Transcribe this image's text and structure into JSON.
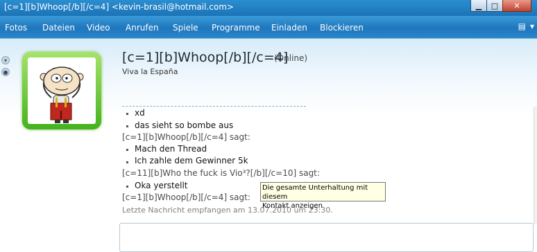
{
  "window": {
    "title": "[c=1][b]Whoop[/b][/c=4] <kevin-brasil@hotmail.com>"
  },
  "menu": {
    "items": [
      {
        "label": "Fotos"
      },
      {
        "label": "Dateien"
      },
      {
        "label": "Video"
      },
      {
        "label": "Anrufen"
      },
      {
        "label": "Spiele"
      },
      {
        "label": "Programme"
      },
      {
        "label": "Einladen"
      },
      {
        "label": "Blockieren"
      }
    ]
  },
  "contact": {
    "name": "[c=1][b]Whoop[/b][/c=4]",
    "status": "(Online)",
    "personal_message": "Viva la España"
  },
  "conversation": {
    "lines": [
      {
        "kind": "message",
        "text": "xd"
      },
      {
        "kind": "message",
        "text": "das sieht so bombe aus"
      },
      {
        "kind": "sender",
        "text": "[c=1][b]Whoop[/b][/c=4] sagt:"
      },
      {
        "kind": "message",
        "text": "Mach den Thread"
      },
      {
        "kind": "message",
        "text": "Ich zahle dem Gewinner 5k"
      },
      {
        "kind": "sender",
        "text": "[c=11][b]Who the fuck is Vio³?[/b][/c=10] sagt:"
      },
      {
        "kind": "message",
        "text": "Oka yerstellt"
      },
      {
        "kind": "sender",
        "text": "[c=1][b]Whoop[/b][/c=4] sagt:"
      }
    ],
    "last_received": "Letzte Nachricht empfangen am 13.07.2010 um 23:30."
  },
  "tooltip": {
    "line1": "Die gesamte Unterhaltung mit diesem",
    "line2": "Kontakt anzeigen"
  },
  "colors": {
    "accent": "#1e77bd",
    "avatar_border": "#44b21d"
  }
}
